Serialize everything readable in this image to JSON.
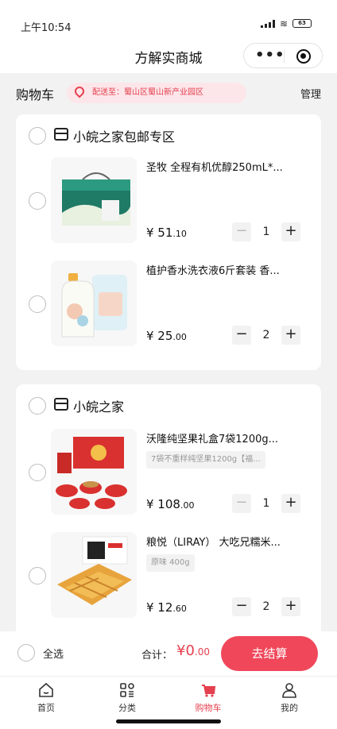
{
  "status_bar": {
    "time": "上午10:54",
    "battery": "63"
  },
  "nav": {
    "title": "方解实商城"
  },
  "cart_header": {
    "title": "购物车",
    "address": "配送至：蜀山区蜀山新产业园区",
    "manage": "管理"
  },
  "shops": [
    {
      "name": "小皖之家包邮专区",
      "items": [
        {
          "title": "圣牧 全程有机优醇250mL*...",
          "spec": "",
          "price_int": "¥ 51",
          "price_dec": ".10",
          "qty": "1"
        },
        {
          "title": "植护香水洗衣液6斤套装 香...",
          "spec": "",
          "price_int": "¥ 25",
          "price_dec": ".00",
          "qty": "2"
        }
      ]
    },
    {
      "name": "小皖之家",
      "items": [
        {
          "title": "沃隆纯坚果礼盒7袋1200g...",
          "spec": "7袋不重样纯坚果1200g【福...",
          "price_int": "¥ 108",
          "price_dec": ".00",
          "qty": "1"
        },
        {
          "title": "粮悦（LIRAY） 大吃兄糯米...",
          "spec": "原味 400g",
          "price_int": "¥ 12",
          "price_dec": ".60",
          "qty": "2"
        }
      ]
    }
  ],
  "stepper": {
    "minus": "−",
    "plus": "+"
  },
  "bottom_bar": {
    "select_all": "全选",
    "total_label": "合计：",
    "total_int": "¥0",
    "total_dec": ".00",
    "checkout": "去结算"
  },
  "tabs": [
    {
      "label": "首页",
      "icon": "home-icon"
    },
    {
      "label": "分类",
      "icon": "category-icon"
    },
    {
      "label": "购物车",
      "icon": "cart-icon",
      "active": true
    },
    {
      "label": "我的",
      "icon": "profile-icon"
    }
  ],
  "colors": {
    "accent": "#f0475a",
    "address_bg": "#fde6ea"
  }
}
